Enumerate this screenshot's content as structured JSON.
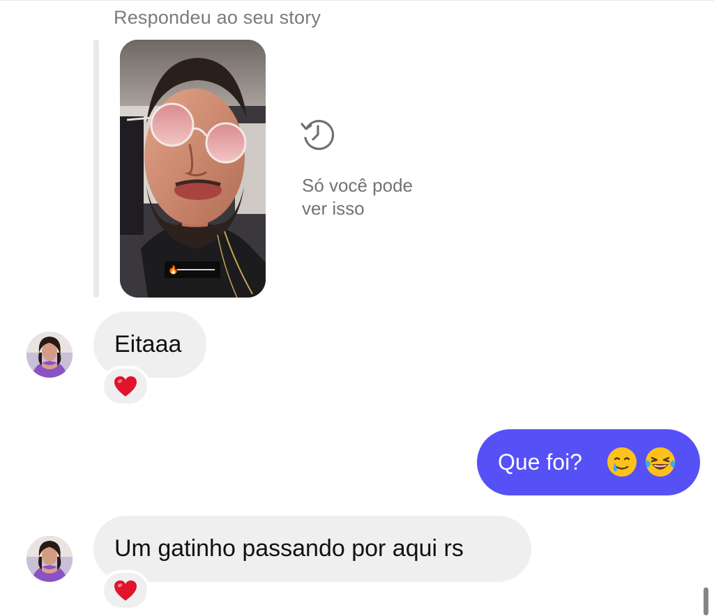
{
  "thread": {
    "story_reply_context": "Respondeu ao seu story",
    "story_preview": {
      "subject": "story photo of a man wearing round pink-tinted sunglasses in a car",
      "expired_icon": "history-clock-icon",
      "expired_note_line1": "Só você pode",
      "expired_note_line2": "ver isso"
    },
    "messages": [
      {
        "direction": "incoming",
        "text": "Eitaaa",
        "avatar_icon": "contact-avatar",
        "reaction": "❤️",
        "reaction_icon": "heart-reaction-icon"
      },
      {
        "direction": "outgoing",
        "text": "Que foi?",
        "emojis": [
          "🥲",
          "😂"
        ]
      },
      {
        "direction": "incoming",
        "text": "Um gatinho passando por aqui rs",
        "avatar_icon": "contact-avatar",
        "reaction": "❤️",
        "reaction_icon": "heart-reaction-icon"
      }
    ]
  },
  "colors": {
    "incoming_bubble": "#efefef",
    "outgoing_bubble": "#5551f7",
    "secondary_text": "#7a7a7a",
    "reaction_heart": "#e0142d"
  }
}
